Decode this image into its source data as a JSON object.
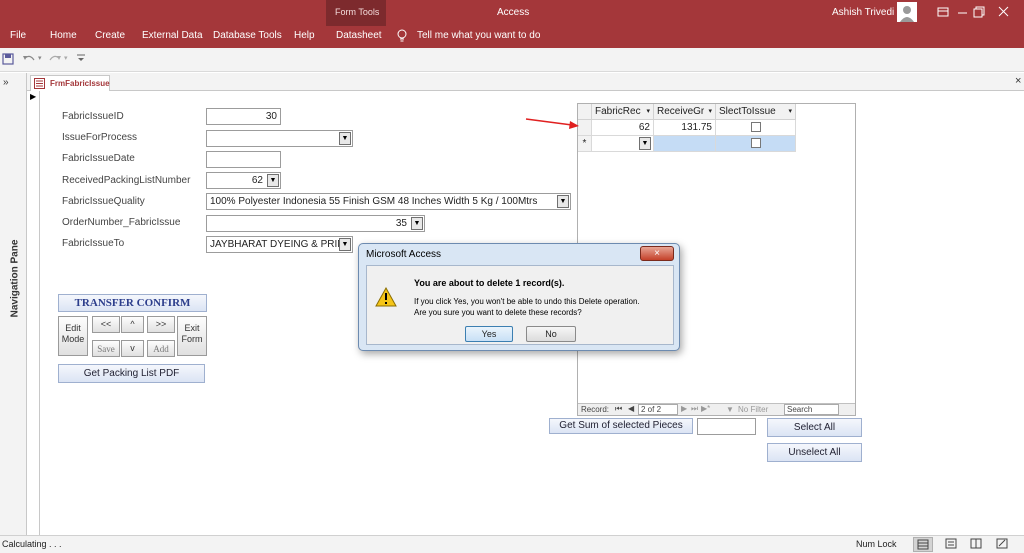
{
  "window": {
    "context_group": "Form Tools",
    "app_title": "Access",
    "user_name": "Ashish Trivedi"
  },
  "ribbon": {
    "tabs": [
      "File",
      "Home",
      "Create",
      "External Data",
      "Database Tools",
      "Help",
      "Datasheet"
    ],
    "tell_me": "Tell me what you want to do"
  },
  "document_tab": "FrmFabricIssue",
  "navigation_pane": "Navigation Pane",
  "form": {
    "fields": [
      {
        "label": "FabricIssueID",
        "value": "30"
      },
      {
        "label": "IssueForProcess",
        "value": ""
      },
      {
        "label": "FabricIssueDate",
        "value": ""
      },
      {
        "label": "ReceivedPackingListNumber",
        "value": "62"
      },
      {
        "label": "FabricIssueQuality",
        "value": "100% Polyester Indonesia 55 Finish GSM 48 Inches Width 5 Kg / 100Mtrs"
      },
      {
        "label": "OrderNumber_FabricIssue",
        "value": "35"
      },
      {
        "label": "FabricIssueTo",
        "value": "JAYBHARAT DYEING & PRINT"
      }
    ],
    "transfer_confirm": "TRANSFER CONFIRM",
    "edit_mode": "Edit Mode",
    "first": "<<",
    "up": "^",
    "last": ">>",
    "save": "Save",
    "down": "v",
    "add": "Add",
    "exit_form": "Exit Form",
    "get_packing_list": "Get Packing List PDF",
    "get_sum": "Get Sum of selected Pieces",
    "sum_value": "",
    "select_all": "Select All",
    "unselect_all": "Unselect All"
  },
  "grid": {
    "columns": [
      "FabricRec",
      "ReceiveGr",
      "SlectToIssue"
    ],
    "rows": [
      {
        "FabricRec": "62",
        "ReceiveGr": "131.75"
      }
    ],
    "new_row_marker": "*",
    "navbar": {
      "record_label": "Record:",
      "position": "2 of 2",
      "filter": "No Filter",
      "search": "Search"
    }
  },
  "dialog": {
    "title": "Microsoft Access",
    "heading": "You are about to delete 1 record(s).",
    "line1": "If you click Yes, you won't be able to undo this Delete operation.",
    "line2": "Are you sure you want to delete these records?",
    "yes": "Yes",
    "no": "No"
  },
  "status": {
    "left": "Calculating . . .",
    "num_lock": "Num Lock"
  },
  "colors": {
    "accent": "#a4373a",
    "context_band": "#7d2a2d",
    "arrow": "#e02020"
  }
}
